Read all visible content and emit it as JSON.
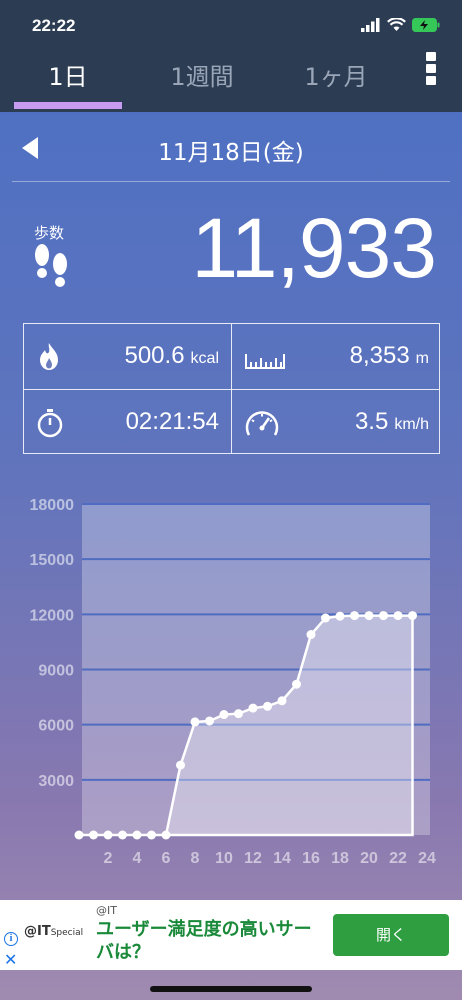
{
  "status_bar": {
    "time": "22:22"
  },
  "tabs": [
    {
      "label": "1日",
      "active": true
    },
    {
      "label": "1週間",
      "active": false
    },
    {
      "label": "1ヶ月",
      "active": false
    }
  ],
  "date": {
    "label": "11月18日(金)"
  },
  "steps": {
    "label": "歩数",
    "value": "11,933"
  },
  "stats": {
    "calories": {
      "value": "500.6",
      "unit": "kcal"
    },
    "distance": {
      "value": "8,353",
      "unit": "m"
    },
    "duration": {
      "value": "02:21:54"
    },
    "speed": {
      "value": "3.5",
      "unit": "km/h"
    }
  },
  "colors": {
    "header": "#2c3c52",
    "tab_indicator": "#c79cf0",
    "ad_button": "#2e9e40"
  },
  "chart_data": {
    "type": "area",
    "y_ticks": [
      "18000",
      "15000",
      "12000",
      "9000",
      "6000",
      "3000"
    ],
    "x_ticks": [
      "2",
      "4",
      "6",
      "8",
      "10",
      "12",
      "14",
      "16",
      "18",
      "20",
      "22",
      "24"
    ],
    "ylim": [
      0,
      18000
    ],
    "xlim": [
      0,
      24
    ],
    "x": [
      0,
      1,
      2,
      3,
      4,
      5,
      6,
      7,
      8,
      9,
      10,
      11,
      12,
      13,
      14,
      15,
      16,
      17,
      18,
      19,
      20,
      21,
      22,
      23
    ],
    "values": [
      0,
      0,
      0,
      0,
      0,
      0,
      0,
      3800,
      6150,
      6200,
      6550,
      6600,
      6900,
      7000,
      7300,
      8200,
      10900,
      11800,
      11900,
      11933,
      11933,
      11933,
      11933,
      11933
    ]
  },
  "ad": {
    "logo": "@IT",
    "logo_sub": "Special",
    "source": "@IT",
    "headline": "ユーザー満足度の高いサーバは？",
    "button": "開く",
    "info": "i",
    "close": "✕"
  }
}
